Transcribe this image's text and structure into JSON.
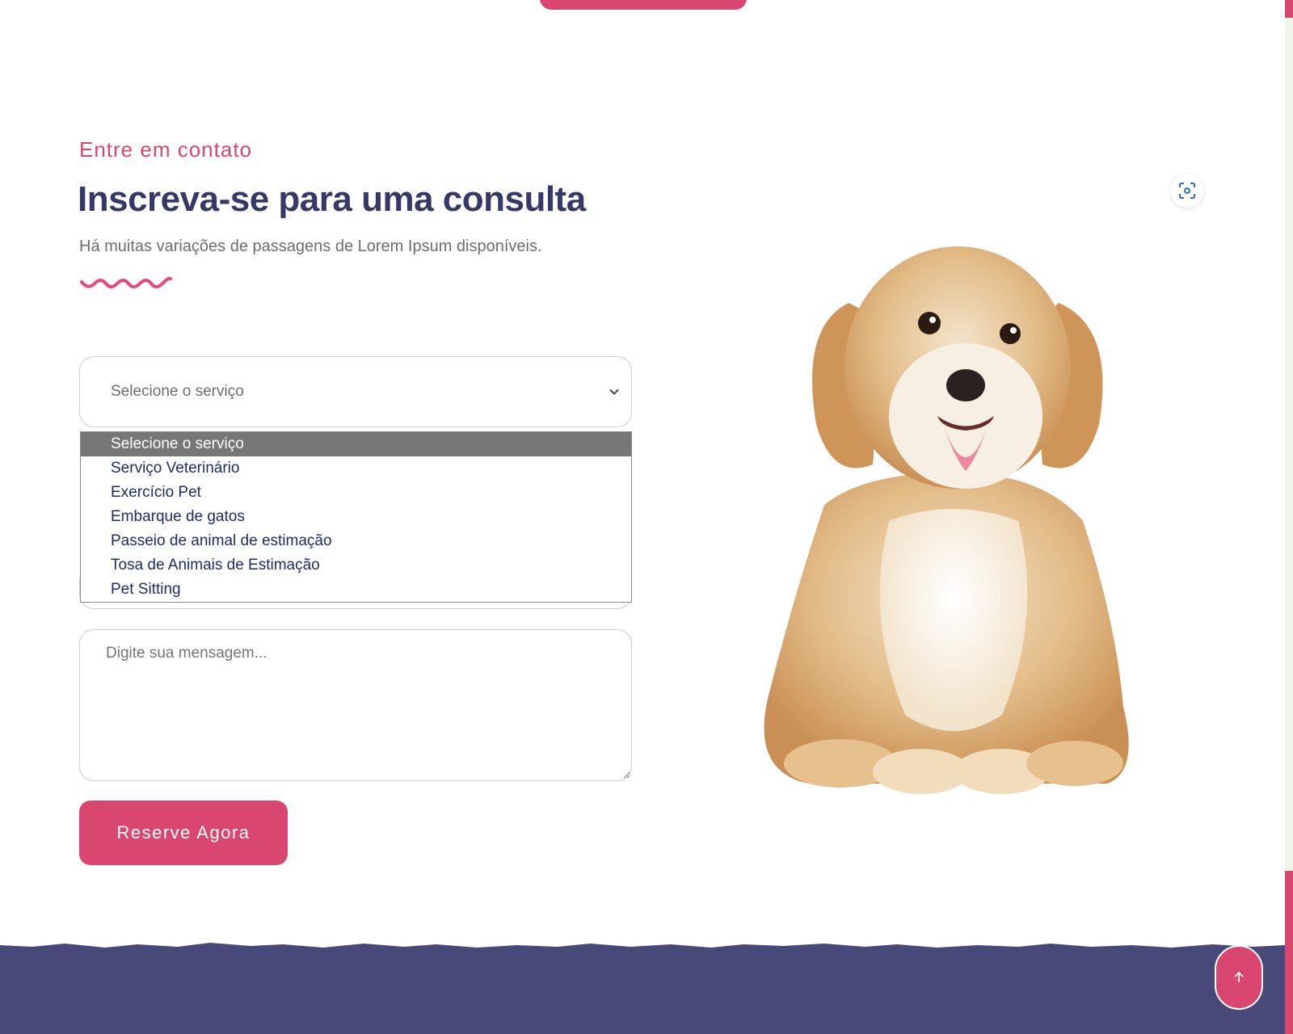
{
  "section": {
    "eyebrow": "Entre em contato",
    "heading": "Inscreva-se para uma consulta",
    "subtext": "Há muitas variações de passagens de Lorem Ipsum disponíveis."
  },
  "form": {
    "service_select": {
      "selected": "Selecione o serviço",
      "options": [
        "Selecione o serviço",
        "Serviço Veterinário",
        "Exercício Pet",
        "Embarque de gatos",
        "Passeio de animal de estimação",
        "Tosa de Animais de Estimação",
        "Pet Sitting"
      ]
    },
    "message_placeholder": "Digite sua mensagem...",
    "submit_label": "Reserve Agora"
  },
  "colors": {
    "accent": "#d9466f",
    "heading": "#353869",
    "footer": "#474a78"
  },
  "icons": {
    "lens": "visual-search-icon",
    "back_to_top": "arrow-up-icon",
    "dropdown": "chevron-down-icon"
  }
}
